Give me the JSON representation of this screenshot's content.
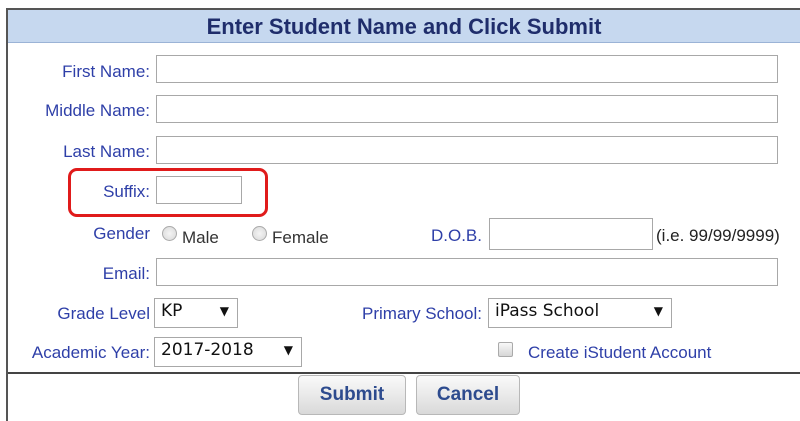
{
  "form": {
    "title": "Enter Student Name and Click Submit",
    "first_name_label": "First Name:",
    "first_name_value": "",
    "middle_name_label": "Middle Name:",
    "middle_name_value": "",
    "last_name_label": "Last Name:",
    "last_name_value": "",
    "suffix_label": "Suffix:",
    "suffix_value": "",
    "gender_label": "Gender",
    "gender_options": [
      "Male",
      "Female"
    ],
    "dob_label": "D.O.B.",
    "dob_value": "",
    "dob_hint": "(i.e. 99/99/9999)",
    "email_label": "Email:",
    "email_value": "",
    "grade_level_label": "Grade Level",
    "grade_level_selected": "KP",
    "primary_school_label": "Primary School:",
    "primary_school_selected": "iPass School",
    "academic_year_label": "Academic Year:",
    "academic_year_selected": "2017-2018",
    "create_account_label": "Create iStudent Account",
    "create_account_checked": false
  },
  "buttons": {
    "submit_label": "Submit",
    "cancel_label": "Cancel"
  },
  "icons": {
    "dropdown_arrow": "▼"
  },
  "colors": {
    "title_bg": "#c6d8ef",
    "label_color": "#2e3fa8",
    "highlight": "#e01b1b"
  }
}
